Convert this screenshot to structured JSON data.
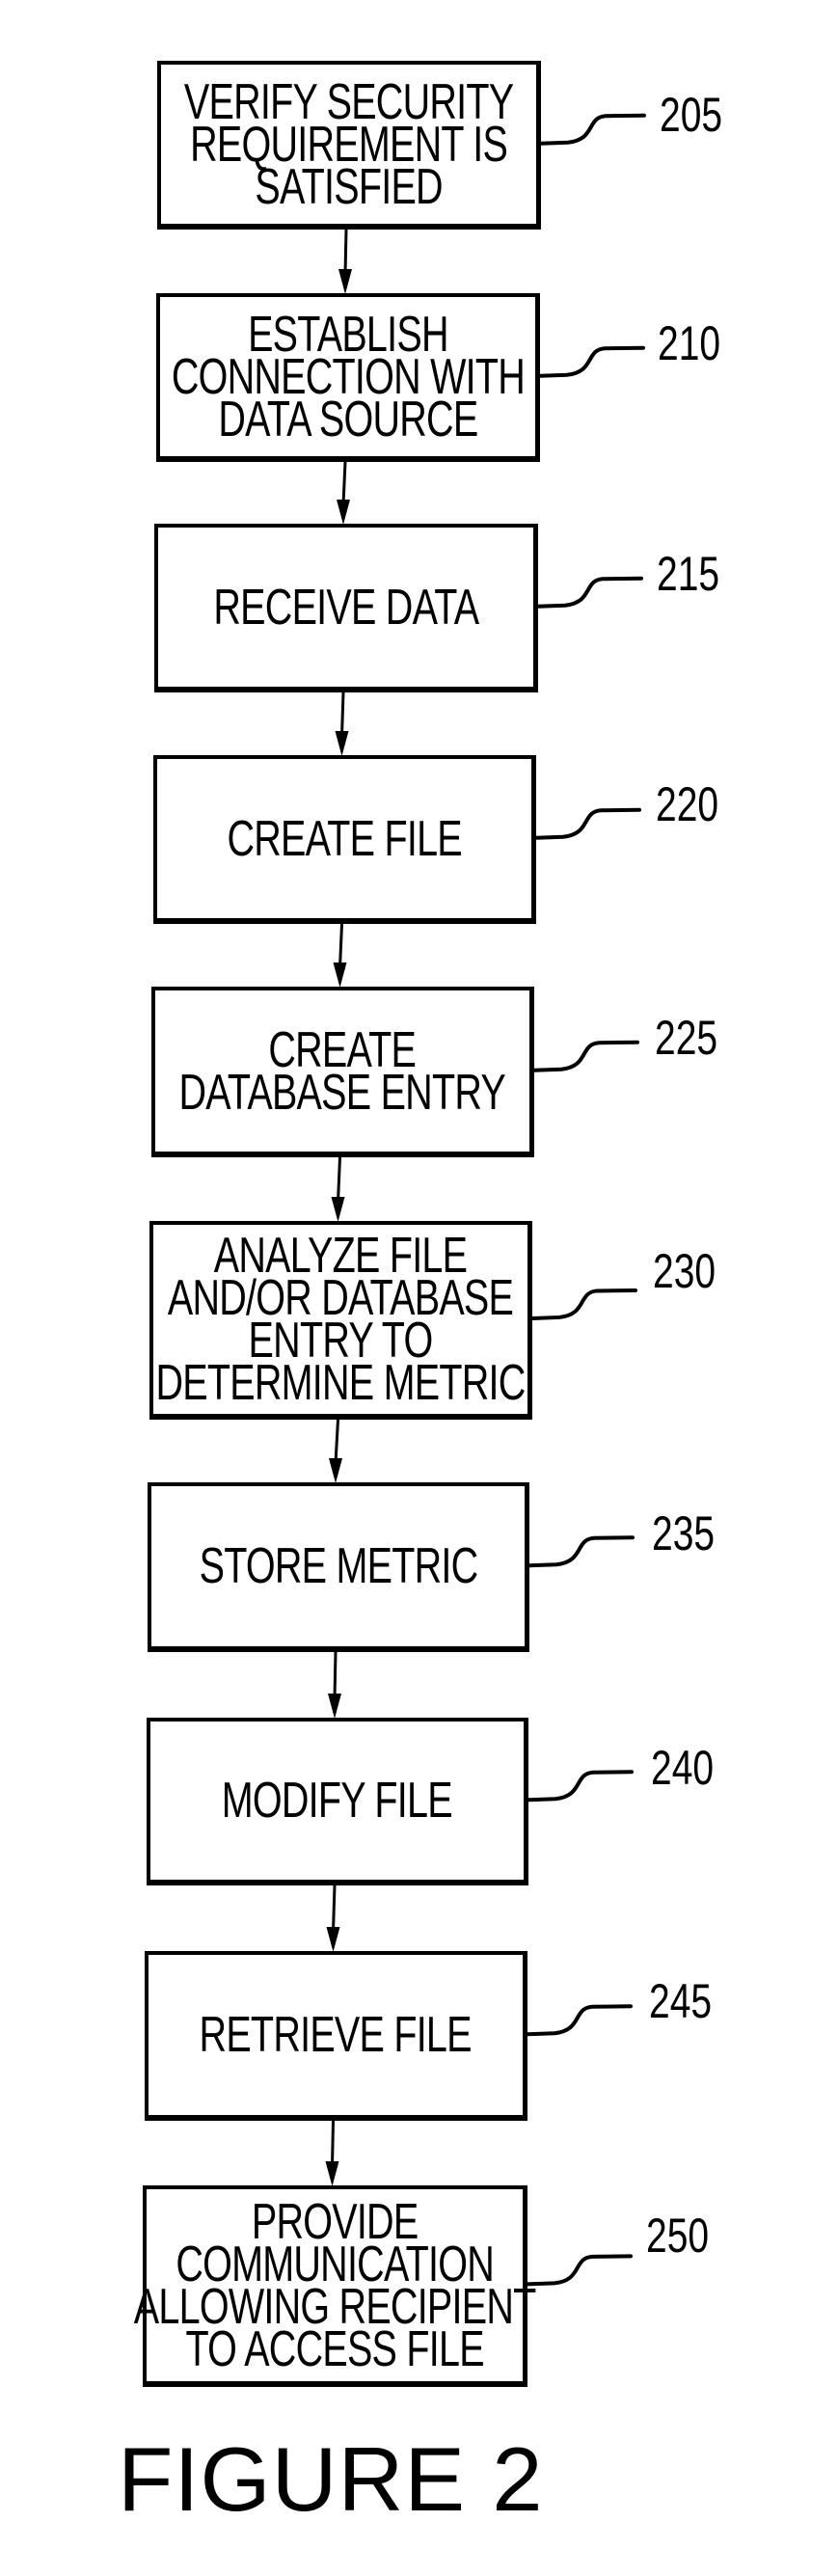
{
  "figure": {
    "caption": "FIGURE 2"
  },
  "steps": [
    {
      "ref": "205",
      "lines": [
        "VERIFY SECURITY",
        "REQUIREMENT IS",
        "SATISFIED"
      ]
    },
    {
      "ref": "210",
      "lines": [
        "ESTABLISH",
        "CONNECTION WITH",
        "DATA SOURCE"
      ]
    },
    {
      "ref": "215",
      "lines": [
        "RECEIVE DATA"
      ]
    },
    {
      "ref": "220",
      "lines": [
        "CREATE FILE"
      ]
    },
    {
      "ref": "225",
      "lines": [
        "CREATE",
        "DATABASE ENTRY"
      ]
    },
    {
      "ref": "230",
      "lines": [
        "ANALYZE FILE",
        "AND/OR DATABASE",
        "ENTRY TO",
        "DETERMINE METRIC"
      ]
    },
    {
      "ref": "235",
      "lines": [
        "STORE METRIC"
      ]
    },
    {
      "ref": "240",
      "lines": [
        "MODIFY FILE"
      ]
    },
    {
      "ref": "245",
      "lines": [
        "RETRIEVE FILE"
      ]
    },
    {
      "ref": "250",
      "lines": [
        "PROVIDE",
        "COMMUNICATION",
        "ALLOWING RECIPIENT",
        "TO ACCESS FILE"
      ]
    }
  ],
  "flow": {
    "direction": "top-to-bottom",
    "connections": [
      [
        "205",
        "210"
      ],
      [
        "210",
        "215"
      ],
      [
        "215",
        "220"
      ],
      [
        "220",
        "225"
      ],
      [
        "225",
        "230"
      ],
      [
        "230",
        "235"
      ],
      [
        "235",
        "240"
      ],
      [
        "240",
        "245"
      ],
      [
        "245",
        "250"
      ]
    ]
  }
}
